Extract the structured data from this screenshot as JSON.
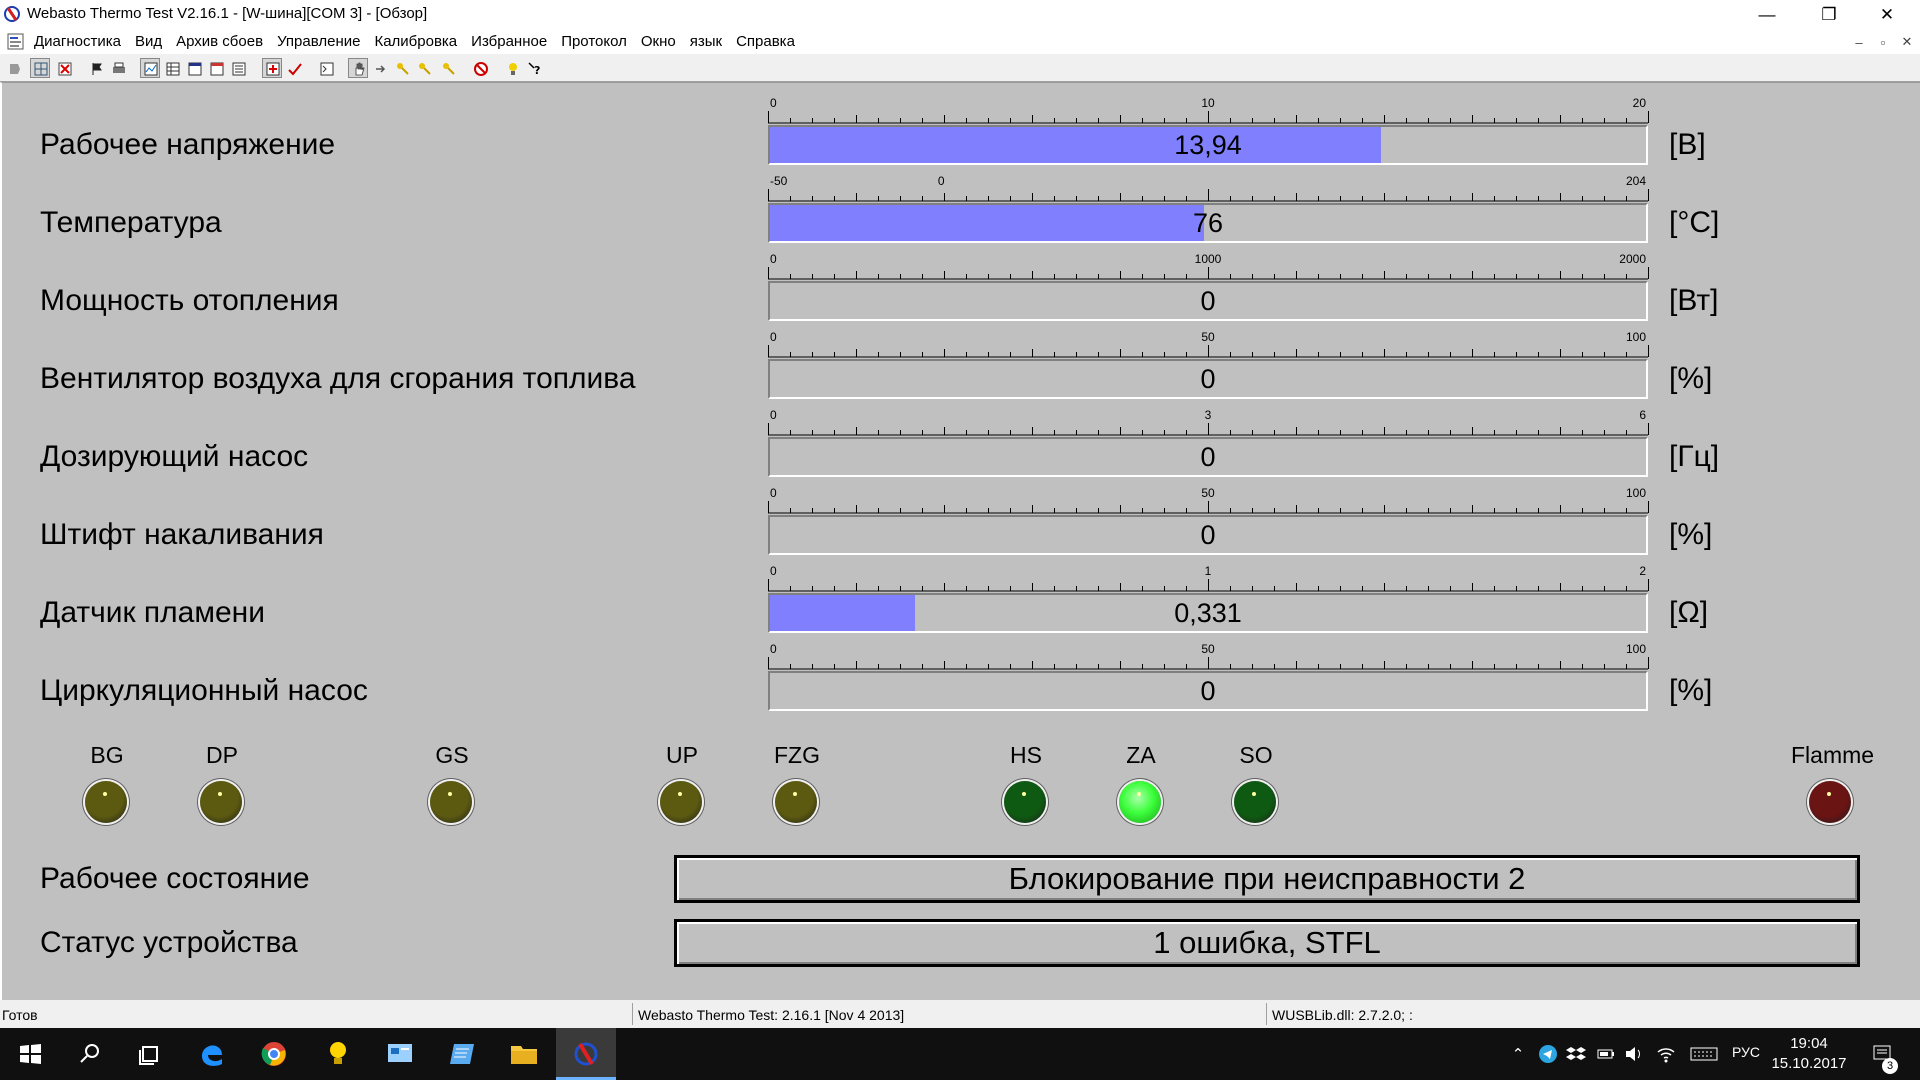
{
  "window": {
    "title": "Webasto Thermo Test V2.16.1 - [W-шина][COM 3] - [Обзор]",
    "min_glyph": "—",
    "restore_glyph": "❐",
    "close_glyph": "✕"
  },
  "menu": {
    "items": [
      "Диагностика",
      "Вид",
      "Архив сбоев",
      "Управление",
      "Калибровка",
      "Избранное",
      "Протокол",
      "Окно",
      "язык",
      "Справка"
    ],
    "mdi_min": "–",
    "mdi_restore": "▫",
    "mdi_close": "✕"
  },
  "toolbar": {
    "buttons": [
      "back-icon",
      "grid-icon",
      "delete-icon",
      "flag-icon",
      "print-icon",
      "chart-icon",
      "table-icon",
      "window-icon",
      "window2-icon",
      "list-icon",
      "add-icon",
      "check-icon",
      "terminal-icon",
      "hand-icon",
      "arrow-icon",
      "key-icon",
      "key2-icon",
      "key3-icon",
      "stop-icon",
      "bulb-icon",
      "help-icon"
    ]
  },
  "measurements": [
    {
      "label": "Рабочее напряжение",
      "unit": "[В]",
      "value_text": "13,94",
      "value": 13.94,
      "min": 0,
      "max": 20,
      "tick_labels": [
        "0",
        "10",
        "20"
      ],
      "fill": 0.697
    },
    {
      "label": "Температура",
      "unit": "[°C]",
      "value_text": "76",
      "value": 76,
      "min": -50,
      "max": 204,
      "tick_labels": [
        "-50",
        "0",
        "204"
      ],
      "fill": 0.496
    },
    {
      "label": "Мощность отопления",
      "unit": "[Вт]",
      "value_text": "0",
      "value": 0,
      "min": 0,
      "max": 2000,
      "tick_labels": [
        "0",
        "1000",
        "2000"
      ],
      "fill": 0
    },
    {
      "label": "Вентилятор воздуха для сгорания топлива",
      "unit": "[%]",
      "value_text": "0",
      "value": 0,
      "min": 0,
      "max": 100,
      "tick_labels": [
        "0",
        "50",
        "100"
      ],
      "fill": 0
    },
    {
      "label": "Дозирующий насос",
      "unit": "[Гц]",
      "value_text": "0",
      "value": 0,
      "min": 0,
      "max": 6,
      "tick_labels": [
        "0",
        "3",
        "6"
      ],
      "fill": 0
    },
    {
      "label": "Штифт накаливания",
      "unit": "[%]",
      "value_text": "0",
      "value": 0,
      "min": 0,
      "max": 100,
      "tick_labels": [
        "0",
        "50",
        "100"
      ],
      "fill": 0
    },
    {
      "label": "Датчик пламени",
      "unit": "[Ω]",
      "value_text": "0,331",
      "value": 0.331,
      "min": 0,
      "max": 2,
      "tick_labels": [
        "0",
        "1",
        "2"
      ],
      "fill": 0.165
    },
    {
      "label": "Циркуляционный насос",
      "unit": "[%]",
      "value_text": "0",
      "value": 0,
      "min": 0,
      "max": 100,
      "tick_labels": [
        "0",
        "50",
        "100"
      ],
      "fill": 0
    }
  ],
  "leds": [
    {
      "label": "BG",
      "state": "off",
      "color": "#5c5a10"
    },
    {
      "label": "DP",
      "state": "off",
      "color": "#5c5a10"
    },
    {
      "label": "GS",
      "state": "off",
      "color": "#5c5a10"
    },
    {
      "label": "UP",
      "state": "off",
      "color": "#5c5a10"
    },
    {
      "label": "FZG",
      "state": "off",
      "color": "#5c5a10"
    },
    {
      "label": "HS",
      "state": "off",
      "color": "#0f5a12"
    },
    {
      "label": "ZA",
      "state": "on",
      "color": "#3cff3c"
    },
    {
      "label": "SO",
      "state": "off",
      "color": "#0f5a12"
    },
    {
      "label": "Flamme",
      "state": "off",
      "color": "#6a1414"
    }
  ],
  "status": {
    "operating_state_label": "Рабочее состояние",
    "operating_state_value": "Блокирование при неисправности 2",
    "device_status_label": "Статус устройства",
    "device_status_value": "1 ошибка, STFL"
  },
  "statusbar": {
    "ready": "Готов",
    "version": "Webasto Thermo Test: 2.16.1 [Nov  4 2013]",
    "lib": "WUSBLib.dll: 2.7.2.0; :"
  },
  "taskbar": {
    "apps": [
      "start-icon",
      "search-icon",
      "task-view-icon",
      "edge-icon",
      "chrome-icon",
      "bulb-app-icon",
      "control-panel-icon",
      "wordpad-icon",
      "file-explorer-icon",
      "webasto-app-icon"
    ],
    "tray_chevron": "⌃",
    "language": "РУС",
    "time": "19:04",
    "date": "15.10.2017",
    "notification_count": "3"
  },
  "colors": {
    "bar_fill": "#8080ff",
    "panel_bg": "#c0c0c0"
  }
}
